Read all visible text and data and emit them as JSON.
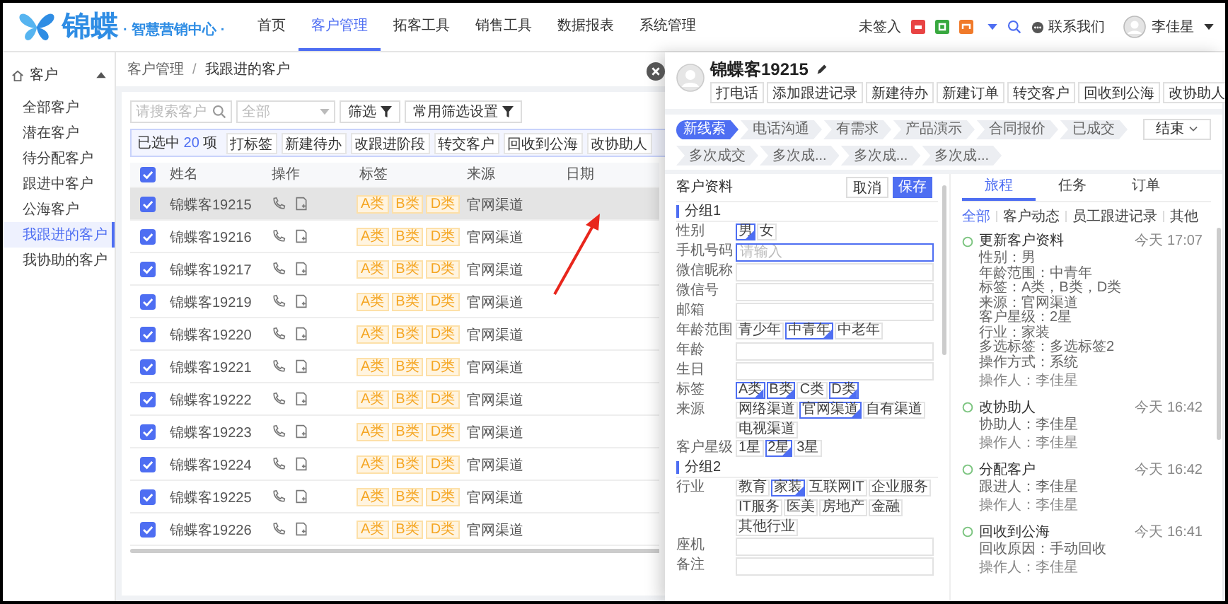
{
  "top_nav": {
    "logo_text": "锦蝶",
    "logo_subtitle": "· 智慧营销中心 ·",
    "items": [
      {
        "label": "首页",
        "selected": false
      },
      {
        "label": "客户管理",
        "selected": true
      },
      {
        "label": "拓客工具",
        "selected": false
      },
      {
        "label": "销售工具",
        "selected": false
      },
      {
        "label": "数据报表",
        "selected": false
      },
      {
        "label": "系统管理",
        "selected": false
      }
    ],
    "status": "未签入",
    "contact": "联系我们",
    "user": "李佳星"
  },
  "sidebar": {
    "group": {
      "label": "客户",
      "expanded": true
    },
    "items": [
      {
        "label": "全部客户",
        "selected": false
      },
      {
        "label": "潜在客户",
        "selected": false
      },
      {
        "label": "待分配客户",
        "selected": false
      },
      {
        "label": "跟进中客户",
        "selected": false
      },
      {
        "label": "公海客户",
        "selected": false
      },
      {
        "label": "我跟进的客户",
        "selected": true
      },
      {
        "label": "我协助的客户",
        "selected": false
      }
    ]
  },
  "breadcrumb": {
    "items": [
      "客户管理",
      "我跟进的客户"
    ],
    "separator": "/"
  },
  "filters": {
    "search_placeholder": "请搜索客户",
    "select_value": "全部",
    "filter_button": "筛选",
    "saved_filters_button": "常用筛选设置"
  },
  "selection_bar": {
    "label": "已选中",
    "count": "20",
    "unit": "项",
    "actions": [
      "打标签",
      "新建待办",
      "改跟进阶段",
      "转交客户",
      "回收到公海",
      "改协助人"
    ]
  },
  "table": {
    "all_checked": true,
    "columns": [
      "姓名",
      "操作",
      "标签",
      "来源",
      "日期"
    ],
    "rows": [
      {
        "name": "锦蝶客19215",
        "tags": [
          "A类",
          "B类",
          "D类"
        ],
        "source": "官网渠道",
        "checked": true,
        "selected": true
      },
      {
        "name": "锦蝶客19216",
        "tags": [
          "A类",
          "B类",
          "D类"
        ],
        "source": "官网渠道",
        "checked": true,
        "selected": false
      },
      {
        "name": "锦蝶客19217",
        "tags": [
          "A类",
          "B类",
          "D类"
        ],
        "source": "官网渠道",
        "checked": true,
        "selected": false
      },
      {
        "name": "锦蝶客19219",
        "tags": [
          "A类",
          "B类",
          "D类"
        ],
        "source": "官网渠道",
        "checked": true,
        "selected": false
      },
      {
        "name": "锦蝶客19220",
        "tags": [
          "A类",
          "B类",
          "D类"
        ],
        "source": "官网渠道",
        "checked": true,
        "selected": false
      },
      {
        "name": "锦蝶客19221",
        "tags": [
          "A类",
          "B类",
          "D类"
        ],
        "source": "官网渠道",
        "checked": true,
        "selected": false
      },
      {
        "name": "锦蝶客19222",
        "tags": [
          "A类",
          "B类",
          "D类"
        ],
        "source": "官网渠道",
        "checked": true,
        "selected": false
      },
      {
        "name": "锦蝶客19223",
        "tags": [
          "A类",
          "B类",
          "D类"
        ],
        "source": "官网渠道",
        "checked": true,
        "selected": false
      },
      {
        "name": "锦蝶客19224",
        "tags": [
          "A类",
          "B类",
          "D类"
        ],
        "source": "官网渠道",
        "checked": true,
        "selected": false
      },
      {
        "name": "锦蝶客19225",
        "tags": [
          "A类",
          "B类",
          "D类"
        ],
        "source": "官网渠道",
        "checked": true,
        "selected": false
      },
      {
        "name": "锦蝶客19226",
        "tags": [
          "A类",
          "B类",
          "D类"
        ],
        "source": "官网渠道",
        "checked": true,
        "selected": false
      }
    ]
  },
  "panel": {
    "customer_name": "锦蝶客19215",
    "actions": [
      "打电话",
      "添加跟进记录",
      "新建待办",
      "新建订单",
      "转交客户",
      "回收到公海",
      "改协助人"
    ],
    "stages": [
      {
        "label": "新线索",
        "selected": true
      },
      {
        "label": "电话沟通",
        "selected": false
      },
      {
        "label": "有需求",
        "selected": false
      },
      {
        "label": "产品演示",
        "selected": false
      },
      {
        "label": "合同报价",
        "selected": false
      },
      {
        "label": "已成交",
        "selected": false
      },
      {
        "label": "多次成交",
        "selected": false
      },
      {
        "label": "多次成...",
        "selected": false
      },
      {
        "label": "多次成...",
        "selected": false
      },
      {
        "label": "多次成...",
        "selected": false
      }
    ],
    "end_button": "结束",
    "form": {
      "title": "客户资料",
      "cancel": "取消",
      "save": "保存",
      "groups": [
        {
          "title": "分组1",
          "fields": [
            {
              "label": "性别",
              "kind": "choice",
              "options": [
                {
                  "label": "男",
                  "selected": true
                },
                {
                  "label": "女",
                  "selected": false
                }
              ]
            },
            {
              "label": "手机号码",
              "kind": "input",
              "placeholder": "请输入",
              "focused": true
            },
            {
              "label": "微信昵称",
              "kind": "input",
              "focused": false
            },
            {
              "label": "微信号",
              "kind": "input",
              "focused": false
            },
            {
              "label": "邮箱",
              "kind": "input",
              "focused": false
            },
            {
              "label": "年龄范围",
              "kind": "choice",
              "options": [
                {
                  "label": "青少年",
                  "selected": false
                },
                {
                  "label": "中青年",
                  "selected": true
                },
                {
                  "label": "中老年",
                  "selected": false
                }
              ]
            },
            {
              "label": "年龄",
              "kind": "input",
              "focused": false
            },
            {
              "label": "生日",
              "kind": "input",
              "focused": false
            },
            {
              "label": "标签",
              "kind": "choice",
              "options": [
                {
                  "label": "A类",
                  "selected": true
                },
                {
                  "label": "B类",
                  "selected": true
                },
                {
                  "label": "C类",
                  "selected": false
                },
                {
                  "label": "D类",
                  "selected": true
                }
              ]
            },
            {
              "label": "来源",
              "kind": "choice",
              "options": [
                {
                  "label": "网络渠道",
                  "selected": false
                },
                {
                  "label": "官网渠道",
                  "selected": true
                },
                {
                  "label": "自有渠道",
                  "selected": false
                },
                {
                  "label": "电视渠道",
                  "selected": false
                }
              ]
            },
            {
              "label": "客户星级",
              "kind": "choice",
              "options": [
                {
                  "label": "1星",
                  "selected": false
                },
                {
                  "label": "2星",
                  "selected": true
                },
                {
                  "label": "3星",
                  "selected": false
                }
              ]
            }
          ]
        },
        {
          "title": "分组2",
          "fields": [
            {
              "label": "行业",
              "kind": "choice",
              "options": [
                {
                  "label": "教育",
                  "selected": false
                },
                {
                  "label": "家装",
                  "selected": true
                },
                {
                  "label": "互联网IT",
                  "selected": false
                },
                {
                  "label": "企业服务",
                  "selected": false
                },
                {
                  "label": "IT服务",
                  "selected": false
                },
                {
                  "label": "医美",
                  "selected": false
                },
                {
                  "label": "房地产",
                  "selected": false
                },
                {
                  "label": "金融",
                  "selected": false
                },
                {
                  "label": "其他行业",
                  "selected": false
                }
              ]
            },
            {
              "label": "座机",
              "kind": "input",
              "focused": false
            },
            {
              "label": "备注",
              "kind": "input",
              "focused": false
            }
          ]
        }
      ]
    },
    "timeline": {
      "tabs": [
        {
          "label": "旅程",
          "selected": true
        },
        {
          "label": "任务",
          "selected": false
        },
        {
          "label": "订单",
          "selected": false
        }
      ],
      "filters": [
        {
          "label": "全部",
          "selected": true
        },
        {
          "label": "客户动态",
          "selected": false
        },
        {
          "label": "员工跟进记录",
          "selected": false
        },
        {
          "label": "其他",
          "selected": false
        }
      ],
      "entries": [
        {
          "title": "更新客户资料",
          "time": "今天 17:07",
          "details": [
            "性别：男",
            "年龄范围：中青年",
            "标签：A类，B类，D类",
            "来源：官网渠道",
            "客户星级：2星",
            "行业：家装",
            "多选标签：多选标签2",
            "操作方式：系统"
          ],
          "operator": "操作人：李佳星"
        },
        {
          "title": "改协助人",
          "time": "今天 16:42",
          "details": [
            "协助人：李佳星"
          ],
          "operator": "操作人：李佳星"
        },
        {
          "title": "分配客户",
          "time": "今天 16:42",
          "details": [
            "跟进人：李佳星"
          ],
          "operator": "操作人：李佳星"
        },
        {
          "title": "回收到公海",
          "time": "今天 16:41",
          "details": [
            "回收原因：手动回收"
          ],
          "operator": "操作人：李佳星"
        }
      ]
    }
  }
}
